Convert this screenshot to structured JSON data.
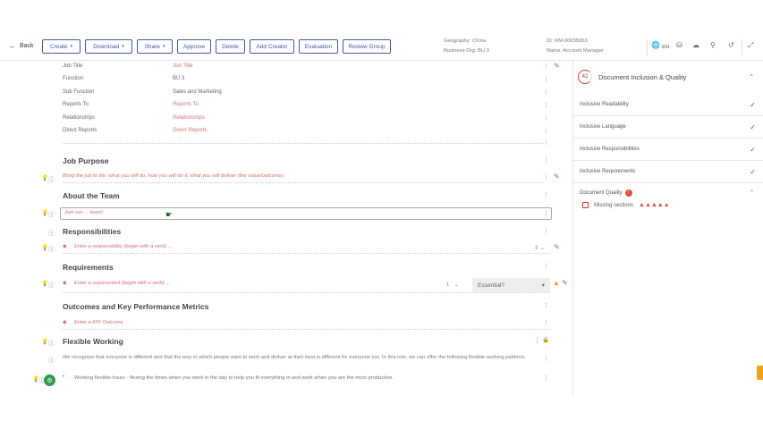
{
  "toolbar": {
    "back_label": "Back",
    "buttons": [
      {
        "label": "Create",
        "dropdown": true
      },
      {
        "label": "Download",
        "dropdown": true
      },
      {
        "label": "Share",
        "dropdown": true
      },
      {
        "label": "Approve",
        "dropdown": false
      },
      {
        "label": "Delete",
        "dropdown": false
      },
      {
        "label": "Add Creator",
        "dropdown": false
      },
      {
        "label": "Evaluation",
        "dropdown": false
      },
      {
        "label": "Review Group",
        "dropdown": false
      }
    ],
    "meta": {
      "geography": "Geography: China",
      "business_org": "Business Org: BU 3",
      "id": "ID: RM-00035653",
      "name": "Name: Account Manager"
    },
    "language": "EN"
  },
  "job_info": {
    "fields": [
      {
        "label": "Job Title",
        "value": "Job Title",
        "placeholder": true
      },
      {
        "label": "Function",
        "value": "BU 3",
        "placeholder": false
      },
      {
        "label": "Sub Function",
        "value": "Sales and Marketing",
        "placeholder": false
      },
      {
        "label": "Reports To",
        "value": "Reports To",
        "placeholder": true
      },
      {
        "label": "Relationships",
        "value": "Relationships",
        "placeholder": true
      },
      {
        "label": "Direct Reports",
        "value": "Direct Reports",
        "placeholder": true
      }
    ]
  },
  "sections": {
    "job_purpose": {
      "title": "Job Purpose",
      "placeholder": "Bring the job to life: what you will do, how you will do it, what you will deliver (the value/outcome)."
    },
    "about_team": {
      "title": "About the Team",
      "placeholder": "Join our ... team!"
    },
    "responsibilities": {
      "title": "Responsibilities",
      "placeholder": "Enter a responsibility (begin with a verb) ..."
    },
    "requirements": {
      "title": "Requirements",
      "placeholder": "Enter a requirement (begin with a verb) ...",
      "essential_label": "Essential?",
      "stepper_value": "1"
    },
    "outcomes": {
      "title": "Outcomes and Key Performance Metrics",
      "placeholder": "Enter a KPI Outcome"
    },
    "flexible": {
      "title": "Flexible Working",
      "intro": "We recognize that everyone is different and that the way in which people want to work and deliver at their best is different for everyone too. In this role, we can offer the following flexible working patterns.",
      "bullet": "Working flexible hours - flexing the times when you work in the day to help you fit everything in and work when you are the most productive."
    }
  },
  "panel": {
    "score": "42",
    "title": "Document Inclusion & Quality",
    "checks": [
      {
        "label": "Inclusive Readability"
      },
      {
        "label": "Inclusive Language"
      },
      {
        "label": "Inclusive Responsibilities"
      },
      {
        "label": "Inclusive Requirements"
      }
    ],
    "quality": {
      "title": "Document Quality",
      "badge": "!",
      "missing_label": "Missing sections"
    }
  },
  "colors": {
    "accent": "#3f5c9a",
    "placeholder": "#d07070",
    "alert": "#e04b3c",
    "green": "#2e9b4a"
  }
}
